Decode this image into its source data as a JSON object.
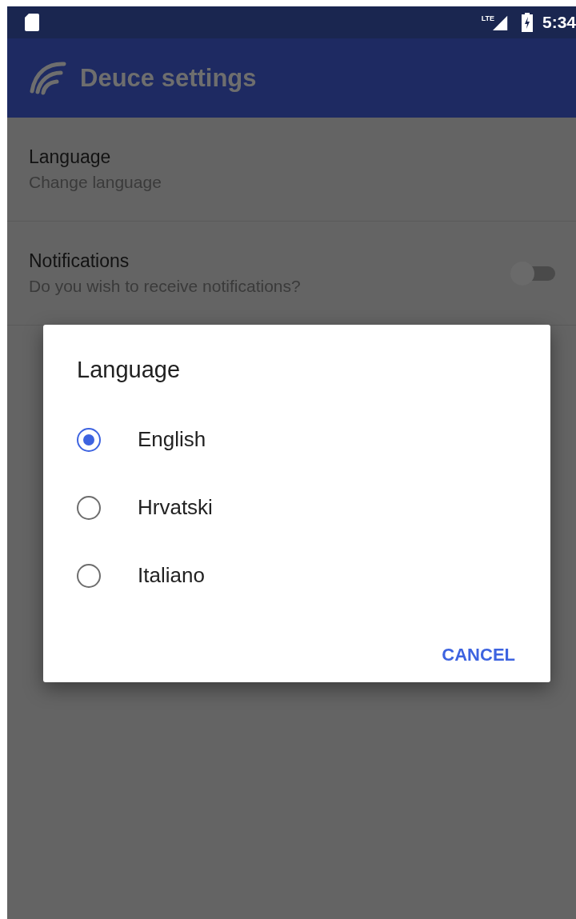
{
  "status_bar": {
    "network": "LTE",
    "time": "5:34"
  },
  "app_bar": {
    "title": "Deuce settings"
  },
  "settings": [
    {
      "kind": "plain",
      "title": "Language",
      "summary": "Change language"
    },
    {
      "kind": "switch",
      "title": "Notifications",
      "summary": "Do you wish to receive notifications?",
      "on": false
    }
  ],
  "dialog": {
    "title": "Language",
    "options": [
      {
        "label": "English",
        "selected": true
      },
      {
        "label": "Hrvatski",
        "selected": false
      },
      {
        "label": "Italiano",
        "selected": false
      }
    ],
    "buttons": [
      "CANCEL"
    ]
  }
}
